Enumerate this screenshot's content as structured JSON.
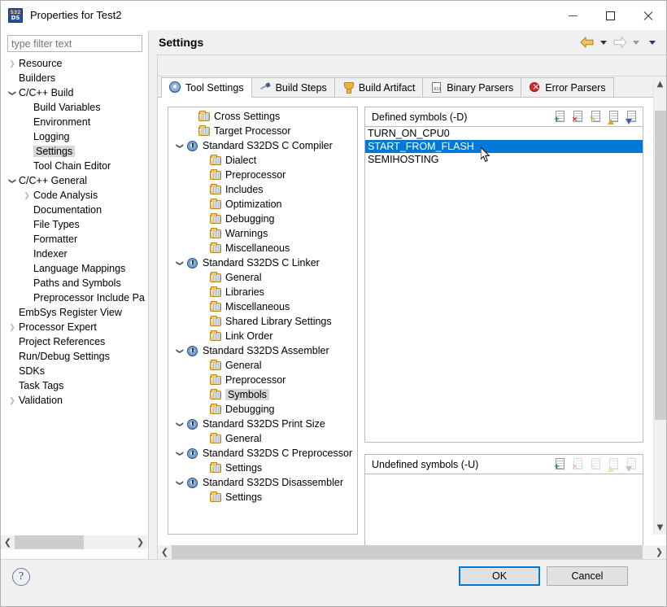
{
  "window": {
    "title": "Properties for Test2",
    "app_icon": "s32ds-icon",
    "minimize": "minimize-icon",
    "maximize": "maximize-icon",
    "close": "close-icon"
  },
  "filter": {
    "placeholder": "type filter text",
    "value": ""
  },
  "sidebar": {
    "items": [
      {
        "label": "Resource",
        "indent": 0,
        "twisty": "collapsed",
        "selected": false
      },
      {
        "label": "Builders",
        "indent": 0,
        "twisty": "none",
        "selected": false
      },
      {
        "label": "C/C++ Build",
        "indent": 0,
        "twisty": "expanded",
        "selected": false
      },
      {
        "label": "Build Variables",
        "indent": 1,
        "twisty": "none",
        "selected": false
      },
      {
        "label": "Environment",
        "indent": 1,
        "twisty": "none",
        "selected": false
      },
      {
        "label": "Logging",
        "indent": 1,
        "twisty": "none",
        "selected": false
      },
      {
        "label": "Settings",
        "indent": 1,
        "twisty": "none",
        "selected": true
      },
      {
        "label": "Tool Chain Editor",
        "indent": 1,
        "twisty": "none",
        "selected": false
      },
      {
        "label": "C/C++ General",
        "indent": 0,
        "twisty": "expanded",
        "selected": false
      },
      {
        "label": "Code Analysis",
        "indent": 1,
        "twisty": "collapsed",
        "selected": false
      },
      {
        "label": "Documentation",
        "indent": 1,
        "twisty": "none",
        "selected": false
      },
      {
        "label": "File Types",
        "indent": 1,
        "twisty": "none",
        "selected": false
      },
      {
        "label": "Formatter",
        "indent": 1,
        "twisty": "none",
        "selected": false
      },
      {
        "label": "Indexer",
        "indent": 1,
        "twisty": "none",
        "selected": false
      },
      {
        "label": "Language Mappings",
        "indent": 1,
        "twisty": "none",
        "selected": false
      },
      {
        "label": "Paths and Symbols",
        "indent": 1,
        "twisty": "none",
        "selected": false
      },
      {
        "label": "Preprocessor Include Pa",
        "indent": 1,
        "twisty": "none",
        "selected": false
      },
      {
        "label": "EmbSys Register View",
        "indent": 0,
        "twisty": "none",
        "selected": false
      },
      {
        "label": "Processor Expert",
        "indent": 0,
        "twisty": "collapsed",
        "selected": false
      },
      {
        "label": "Project References",
        "indent": 0,
        "twisty": "none",
        "selected": false
      },
      {
        "label": "Run/Debug Settings",
        "indent": 0,
        "twisty": "none",
        "selected": false
      },
      {
        "label": "SDKs",
        "indent": 0,
        "twisty": "none",
        "selected": false
      },
      {
        "label": "Task Tags",
        "indent": 0,
        "twisty": "none",
        "selected": false
      },
      {
        "label": "Validation",
        "indent": 0,
        "twisty": "collapsed",
        "selected": false
      }
    ]
  },
  "page": {
    "title": "Settings",
    "nav": {
      "back": "back-arrow-icon",
      "back_menu": "back-dropdown-icon",
      "forward": "forward-arrow-icon",
      "forward_menu": "forward-dropdown-icon",
      "view_menu": "view-menu-icon"
    }
  },
  "tabs": [
    {
      "label": "Tool Settings",
      "icon": "gear-icon",
      "active": true
    },
    {
      "label": "Build Steps",
      "icon": "hammer-icon",
      "active": false
    },
    {
      "label": "Build Artifact",
      "icon": "trophy-icon",
      "active": false
    },
    {
      "label": "Binary Parsers",
      "icon": "binary-icon",
      "active": false
    },
    {
      "label": "Error Parsers",
      "icon": "error-icon",
      "active": false
    }
  ],
  "tool_tree": [
    {
      "label": "Cross Settings",
      "indent": 1,
      "twisty": "none",
      "icon": "folder-icon",
      "selected": false
    },
    {
      "label": "Target Processor",
      "indent": 1,
      "twisty": "none",
      "icon": "folder-icon",
      "selected": false
    },
    {
      "label": "Standard S32DS C Compiler",
      "indent": 0,
      "twisty": "expanded",
      "icon": "gear-icon",
      "selected": false
    },
    {
      "label": "Dialect",
      "indent": 2,
      "twisty": "none",
      "icon": "folder-icon",
      "selected": false
    },
    {
      "label": "Preprocessor",
      "indent": 2,
      "twisty": "none",
      "icon": "folder-icon",
      "selected": false
    },
    {
      "label": "Includes",
      "indent": 2,
      "twisty": "none",
      "icon": "folder-icon",
      "selected": false
    },
    {
      "label": "Optimization",
      "indent": 2,
      "twisty": "none",
      "icon": "folder-icon",
      "selected": false
    },
    {
      "label": "Debugging",
      "indent": 2,
      "twisty": "none",
      "icon": "folder-icon",
      "selected": false
    },
    {
      "label": "Warnings",
      "indent": 2,
      "twisty": "none",
      "icon": "folder-icon",
      "selected": false
    },
    {
      "label": "Miscellaneous",
      "indent": 2,
      "twisty": "none",
      "icon": "folder-icon",
      "selected": false
    },
    {
      "label": "Standard S32DS C Linker",
      "indent": 0,
      "twisty": "expanded",
      "icon": "gear-icon",
      "selected": false
    },
    {
      "label": "General",
      "indent": 2,
      "twisty": "none",
      "icon": "folder-icon",
      "selected": false
    },
    {
      "label": "Libraries",
      "indent": 2,
      "twisty": "none",
      "icon": "folder-icon",
      "selected": false
    },
    {
      "label": "Miscellaneous",
      "indent": 2,
      "twisty": "none",
      "icon": "folder-icon",
      "selected": false
    },
    {
      "label": "Shared Library Settings",
      "indent": 2,
      "twisty": "none",
      "icon": "folder-icon",
      "selected": false
    },
    {
      "label": "Link Order",
      "indent": 2,
      "twisty": "none",
      "icon": "folder-icon",
      "selected": false
    },
    {
      "label": "Standard S32DS Assembler",
      "indent": 0,
      "twisty": "expanded",
      "icon": "gear-icon",
      "selected": false
    },
    {
      "label": "General",
      "indent": 2,
      "twisty": "none",
      "icon": "folder-icon",
      "selected": false
    },
    {
      "label": "Preprocessor",
      "indent": 2,
      "twisty": "none",
      "icon": "folder-icon",
      "selected": false
    },
    {
      "label": "Symbols",
      "indent": 2,
      "twisty": "none",
      "icon": "folder-icon",
      "selected": true
    },
    {
      "label": "Debugging",
      "indent": 2,
      "twisty": "none",
      "icon": "folder-icon",
      "selected": false
    },
    {
      "label": "Standard S32DS Print Size",
      "indent": 0,
      "twisty": "expanded",
      "icon": "gear-icon",
      "selected": false
    },
    {
      "label": "General",
      "indent": 2,
      "twisty": "none",
      "icon": "folder-icon",
      "selected": false
    },
    {
      "label": "Standard S32DS C Preprocessor",
      "indent": 0,
      "twisty": "expanded",
      "icon": "gear-icon",
      "selected": false
    },
    {
      "label": "Settings",
      "indent": 2,
      "twisty": "none",
      "icon": "folder-icon",
      "selected": false
    },
    {
      "label": "Standard S32DS Disassembler",
      "indent": 0,
      "twisty": "expanded",
      "icon": "gear-icon",
      "selected": false
    },
    {
      "label": "Settings",
      "indent": 2,
      "twisty": "none",
      "icon": "folder-icon",
      "selected": false
    }
  ],
  "defined_symbols": {
    "title": "Defined symbols (-D)",
    "tools": [
      {
        "name": "add-icon",
        "enabled": true
      },
      {
        "name": "delete-icon",
        "enabled": true
      },
      {
        "name": "edit-icon",
        "enabled": true
      },
      {
        "name": "move-up-icon",
        "enabled": true
      },
      {
        "name": "move-down-icon",
        "enabled": true
      }
    ],
    "items": [
      {
        "value": "TURN_ON_CPU0",
        "selected": false
      },
      {
        "value": "START_FROM_FLASH",
        "selected": true
      },
      {
        "value": "SEMIHOSTING",
        "selected": false
      }
    ]
  },
  "undefined_symbols": {
    "title": "Undefined symbols (-U)",
    "tools": [
      {
        "name": "add-icon",
        "enabled": true
      },
      {
        "name": "delete-icon",
        "enabled": false
      },
      {
        "name": "edit-icon",
        "enabled": false
      },
      {
        "name": "move-up-icon",
        "enabled": false
      },
      {
        "name": "move-down-icon",
        "enabled": false
      }
    ],
    "items": []
  },
  "footer": {
    "help": "?",
    "ok": "OK",
    "cancel": "Cancel"
  },
  "colors": {
    "selection_blue": "#0078D7",
    "row_highlight": "#D6D6D6",
    "chrome": "#F0F0F0",
    "nav_back": "#E0A424"
  }
}
